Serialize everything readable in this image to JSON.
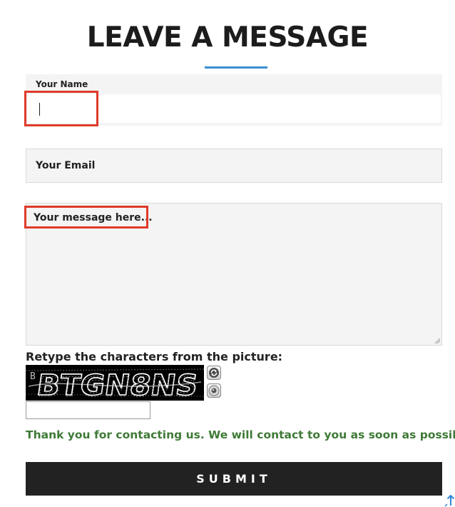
{
  "form": {
    "title": "LEAVE A MESSAGE",
    "name_label": "Your Name",
    "name_value": "",
    "email_placeholder": "Your Email",
    "message_placeholder": "Your message here...",
    "captcha_prompt": "Retype the characters from the picture:",
    "captcha_text": "BTGN8NS",
    "captcha_input_value": "",
    "success_message": "Thank you for contacting us. We will contact to you as soon as possible!",
    "submit_label": "SUBMIT"
  },
  "colors": {
    "accent_underline": "#3a8fd1",
    "highlight": "#e03a2a",
    "success_text": "#3e7a36",
    "submit_bg": "#222222",
    "scroll_icon": "#2f86d6"
  },
  "icons": {
    "captcha_refresh": "refresh-icon",
    "captcha_audio": "speaker-icon",
    "scroll_top": "arrow-up-icon"
  }
}
